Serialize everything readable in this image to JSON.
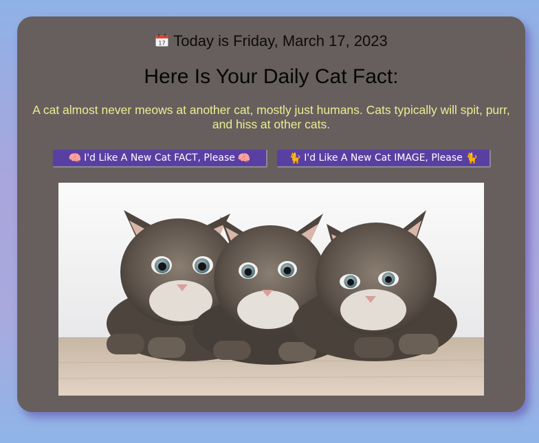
{
  "date_line": {
    "icon": "calendar-icon",
    "text": "Today is Friday, March 17, 2023"
  },
  "headline": "Here Is Your Daily Cat Fact:",
  "fact": "A cat almost never meows at another cat, mostly just humans. Cats typically will spit, purr, and hiss at other cats.",
  "buttons": {
    "new_fact": {
      "icon": "brain-icon",
      "emoji": "🧠",
      "label": "I'd Like A New Cat FACT, Please"
    },
    "new_image": {
      "icon": "cat-icon",
      "emoji": "🐈",
      "label": "I'd Like A New Cat IMAGE, Please"
    }
  },
  "image": {
    "subject": "three tabby kittens on a wooden surface"
  },
  "colors": {
    "card_background": "#665f5d",
    "fact_text": "#f0ec92",
    "button_background": "#5a3fa2",
    "page_gradient_top": "#8fb2e6",
    "page_gradient_mid": "#a8a6dc"
  }
}
